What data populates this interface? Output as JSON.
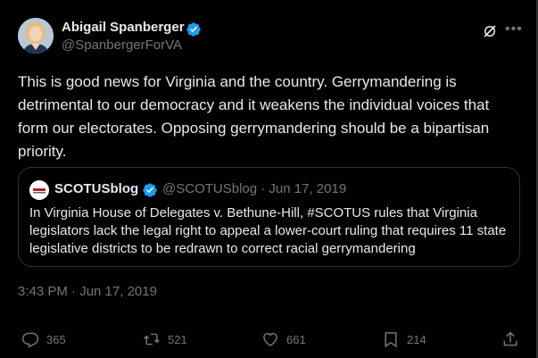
{
  "author": {
    "display_name": "Abigail Spanberger",
    "handle": "@SpanbergerForVA"
  },
  "tweet": {
    "text": "This is good news for Virginia and the country. Gerrymandering is detrimental to our democracy and it weakens the individual voices that form our electorates. Opposing gerrymandering should be a bipartisan priority.",
    "timestamp": "3:43 PM · Jun 17, 2019"
  },
  "quoted_tweet": {
    "display_name": "SCOTUSblog",
    "meta": "@SCOTUSblog · Jun 17, 2019",
    "text": "In Virginia House of Delegates v. Bethune-Hill, #SCOTUS rules that Virginia legislators lack the legal right to appeal a lower-court ruling that requires 11 state legislative districts to be redrawn to correct racial gerrymandering"
  },
  "actions": {
    "replies": "365",
    "retweets": "521",
    "likes": "661",
    "bookmarks": "214"
  },
  "icons": {
    "verified": "verified-badge-icon",
    "grok": "grok-icon",
    "more": "more-icon",
    "reply": "reply-icon",
    "retweet": "retweet-icon",
    "like": "like-icon",
    "bookmark": "bookmark-icon",
    "share": "share-icon"
  },
  "colors": {
    "background": "#000000",
    "text": "#e7e9ea",
    "muted": "#71767b",
    "verified": "#1d9bf0",
    "border": "#2f3336"
  }
}
